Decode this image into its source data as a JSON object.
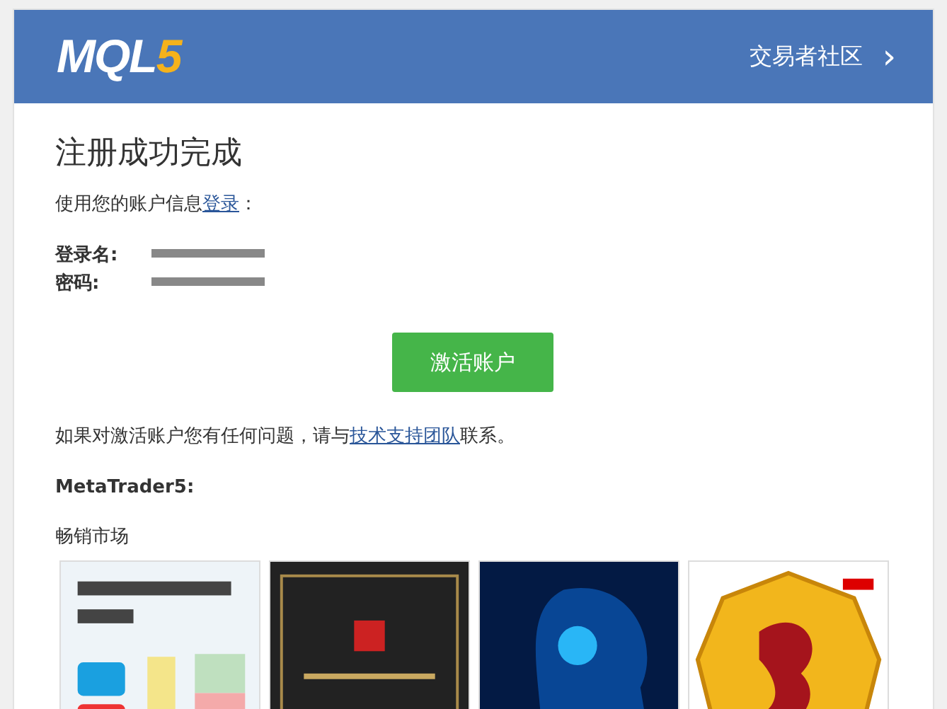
{
  "header": {
    "logo": {
      "main": "MQL",
      "accent": "5"
    },
    "community_link": "交易者社区",
    "chevron": "›"
  },
  "title": "注册成功完成",
  "login_prompt": {
    "text": "使用您的账户信息",
    "link": "登录",
    "suffix": "："
  },
  "credentials": [
    {
      "label": "登录名:"
    },
    {
      "label": "密码:"
    }
  ],
  "activate_button": "激活账户",
  "help": {
    "text": "如果对激活账户您有任何问题，请与",
    "link": "技术支持团队",
    "suffix": "联系。"
  },
  "platform": "MetaTrader5:",
  "market_title": "畅销市场",
  "products": [
    {
      "kind": "assistant"
    },
    {
      "kind": "dark"
    },
    {
      "kind": "ai"
    },
    {
      "kind": "coin"
    }
  ]
}
